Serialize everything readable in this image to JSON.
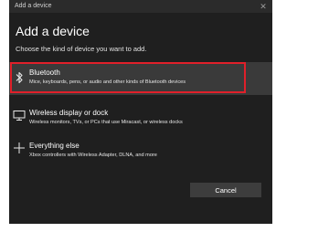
{
  "window": {
    "title": "Add a device",
    "close_glyph": "✕"
  },
  "heading": "Add a device",
  "subheading": "Choose the kind of device you want to add.",
  "options": [
    {
      "icon": "bluetooth-icon",
      "label": "Bluetooth",
      "description": "Mice, keyboards, pens, or audio and other kinds of Bluetooth devices",
      "highlighted": true
    },
    {
      "icon": "monitor-icon",
      "label": "Wireless display or dock",
      "description": "Wireless monitors, TVs, or PCs that use Miracast, or wireless docks",
      "highlighted": false
    },
    {
      "icon": "plus-icon",
      "label": "Everything else",
      "description": "Xbox controllers with Wireless Adapter, DLNA, and more",
      "highlighted": false
    }
  ],
  "buttons": {
    "cancel": "Cancel"
  },
  "colors": {
    "dialog_bg": "#1f1f1f",
    "selected_bg": "#3a3a3a",
    "highlight_border": "#e0202a",
    "button_bg": "#3d3d3d"
  }
}
